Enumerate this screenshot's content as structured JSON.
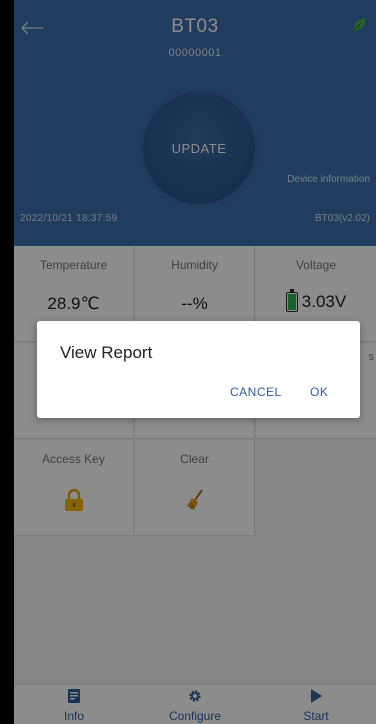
{
  "header": {
    "title": "BT03",
    "serial": "00000001",
    "update_label": "UPDATE",
    "timestamp": "2022/10/21 18:37:59",
    "device_info_label": "Device information",
    "version": "BT03(v2.02)"
  },
  "cards": {
    "temperature": {
      "label": "Temperature",
      "value": "28.9℃"
    },
    "humidity": {
      "label": "Humidity",
      "value": "--%"
    },
    "voltage": {
      "label": "Voltage",
      "value": "3.03V"
    },
    "row2_right_partial": "s",
    "access_key": {
      "label": "Access Key"
    },
    "clear": {
      "label": "Clear"
    }
  },
  "dialog": {
    "title": "View Report",
    "cancel_label": "CANCEL",
    "ok_label": "OK"
  },
  "bottom_nav": {
    "info_label": "Info",
    "configure_label": "Configure",
    "start_label": "Start"
  },
  "icons": {
    "back": "arrow-left-icon",
    "leaf": "leaf-icon",
    "battery": "battery-icon",
    "access_key": "padlock-icon",
    "clear": "broom-icon",
    "info": "document-icon",
    "configure": "gear-icon",
    "start": "play-icon"
  },
  "colors": {
    "header_bg": "#3b6fae",
    "accent": "#2f5e9e",
    "battery_green": "#29b34a",
    "leaf_green": "#4caf50",
    "lock_gold": "#e0a800",
    "broom_orange": "#d98b1f"
  }
}
